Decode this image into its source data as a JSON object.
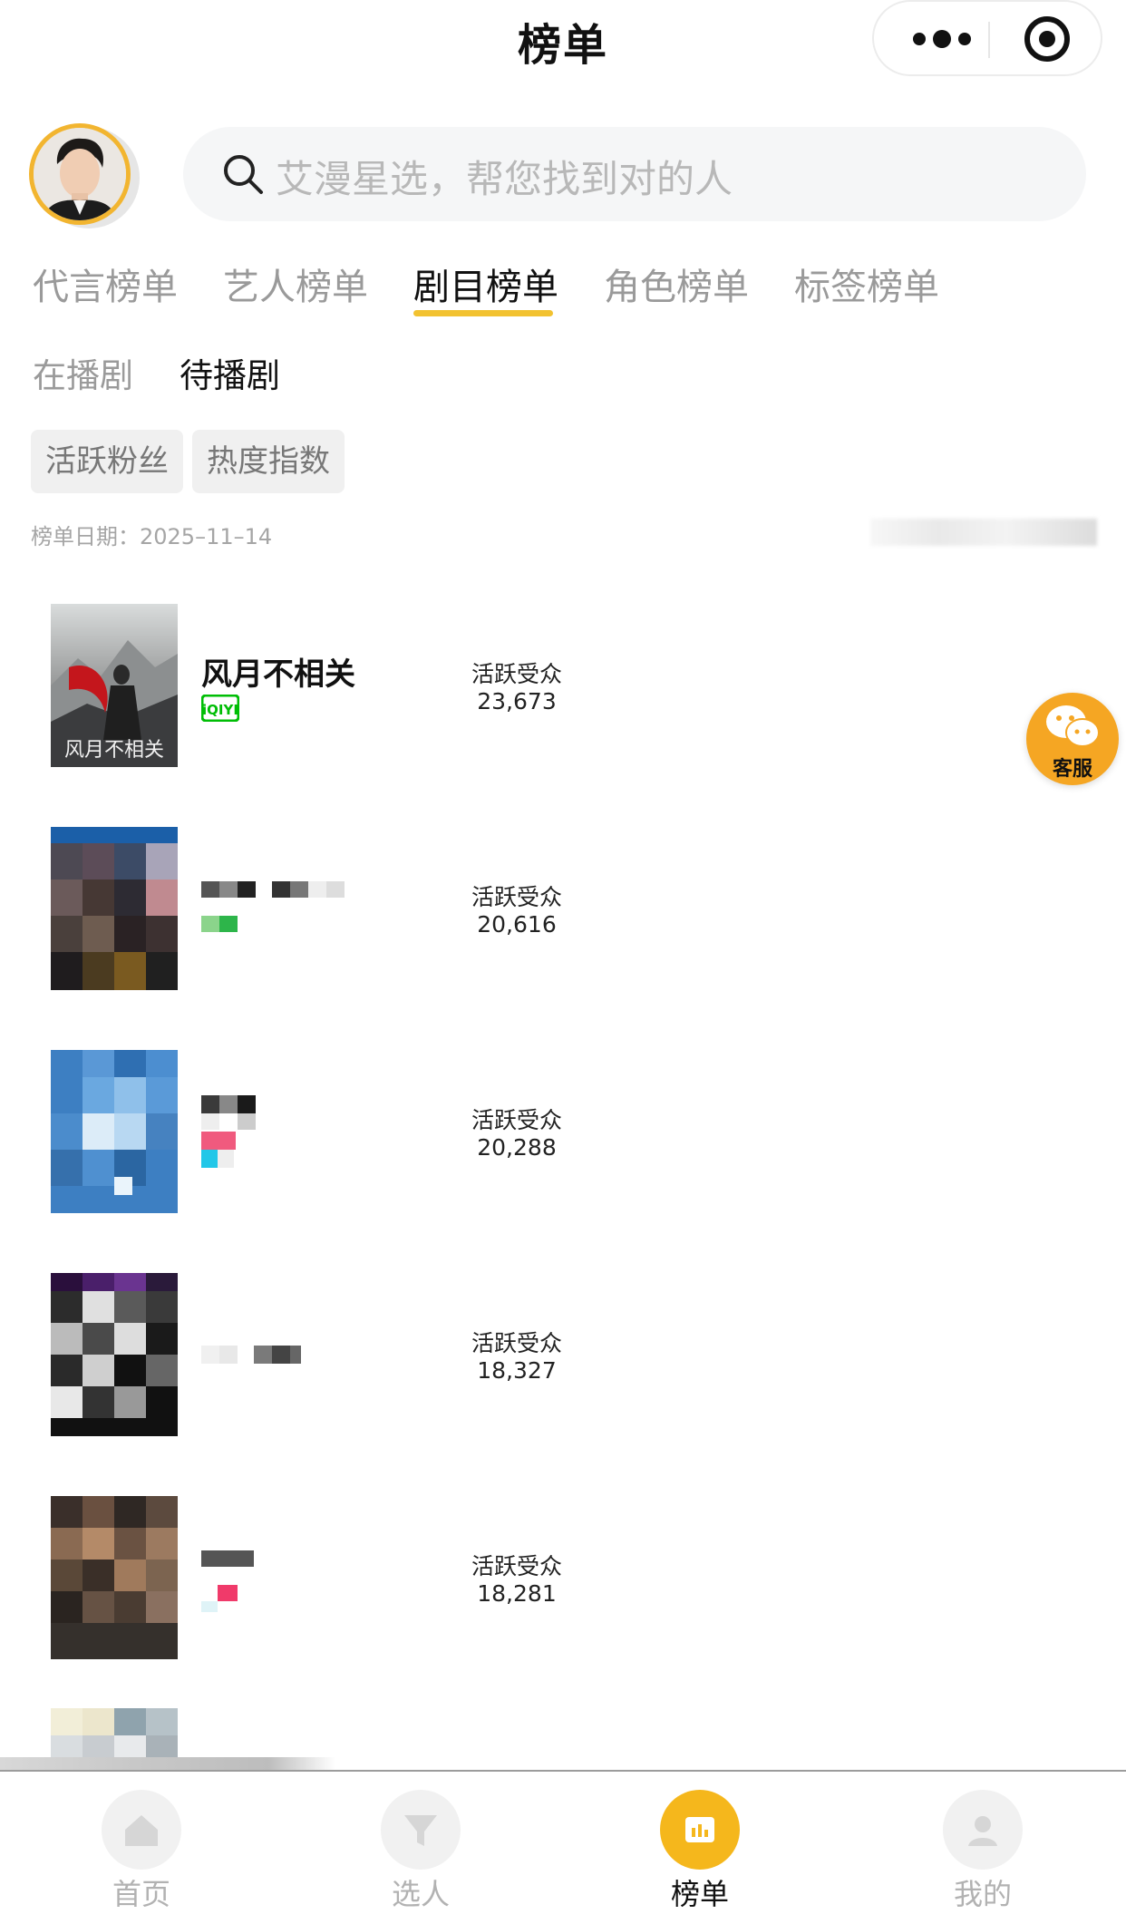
{
  "header": {
    "title": "榜单"
  },
  "search": {
    "placeholder": "艾漫星选，帮您找到对的人"
  },
  "tabs": [
    {
      "label": "代言榜单"
    },
    {
      "label": "艺人榜单"
    },
    {
      "label": "剧目榜单",
      "active": true
    },
    {
      "label": "角色榜单"
    },
    {
      "label": "标签榜单"
    }
  ],
  "subtabs": [
    {
      "label": "在播剧"
    },
    {
      "label": "待播剧",
      "active": true
    }
  ],
  "chips": [
    {
      "label": "活跃粉丝"
    },
    {
      "label": "热度指数"
    }
  ],
  "date_label": "榜单日期：2025–11–14",
  "list": [
    {
      "title": "风月不相关",
      "platform": "iQIYI",
      "metric_label": "活跃受众",
      "metric_value": "23,673"
    },
    {
      "title": "",
      "metric_label": "活跃受众",
      "metric_value": "20,616"
    },
    {
      "title": "",
      "metric_label": "活跃受众",
      "metric_value": "20,288"
    },
    {
      "title": "",
      "metric_label": "活跃受众",
      "metric_value": "18,327"
    },
    {
      "title": "",
      "metric_label": "活跃受众",
      "metric_value": "18,281"
    }
  ],
  "service": {
    "label": "客服"
  },
  "tabbar": [
    {
      "label": "首页",
      "icon": "home-icon"
    },
    {
      "label": "选人",
      "icon": "filter-icon"
    },
    {
      "label": "榜单",
      "icon": "chart-icon",
      "active": true
    },
    {
      "label": "我的",
      "icon": "user-icon"
    }
  ],
  "colors": {
    "accent": "#f2c230",
    "tabbar_active": "#f5b71c",
    "service": "#f5a623",
    "iqiyi": "#00be06"
  }
}
